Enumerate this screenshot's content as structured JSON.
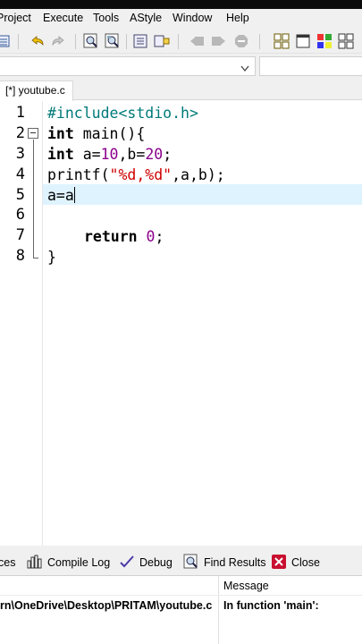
{
  "menubar": {
    "items": [
      "Project",
      "Execute",
      "Tools",
      "AStyle",
      "Window",
      "Help"
    ]
  },
  "toolbar": {
    "icons": [
      "list-icon",
      "undo-icon",
      "redo-icon",
      "find-icon",
      "replace-icon",
      "indent-icon",
      "unindent-icon",
      "back-icon",
      "forward-icon",
      "stop-icon",
      "grid-icon",
      "window-icon",
      "class-browser-icon",
      "tile-icon"
    ]
  },
  "editor_tab": {
    "label": "[*] youtube.c"
  },
  "editor": {
    "line_numbers": [
      "1",
      "2",
      "3",
      "4",
      "5",
      "6",
      "7",
      "8"
    ],
    "lines": {
      "l1": "#include<stdio.h>",
      "l2_kw": "int",
      "l2_rest": " main(){",
      "l3_kw": "int",
      "l3_a": " a=",
      "l3_n1": "10",
      "l3_b": ",b=",
      "l3_n2": "20",
      "l3_end": ";",
      "l4_fn": "printf(",
      "l4_str": "\"%d,%d\"",
      "l4_end": ",a,b);",
      "l5": "a=a",
      "l7_kw": "return",
      "l7_sp": " ",
      "l7_num": "0",
      "l7_end": ";",
      "l8": "}"
    },
    "current_line": 5
  },
  "bottom_tabs": {
    "resources": "ces",
    "compile_log": "Compile Log",
    "debug": "Debug",
    "find_results": "Find Results",
    "close": "Close"
  },
  "messages": {
    "col_message": "Message",
    "row_file": "rn\\OneDrive\\Desktop\\PRITAM\\youtube.c",
    "row_message": "In function 'main':"
  },
  "colors": {
    "menubar_bg": "#f0f0f0",
    "current_line": "#dff3ff",
    "preprocessor": "#007a7a",
    "number": "#8b008b",
    "string": "#d00000"
  }
}
